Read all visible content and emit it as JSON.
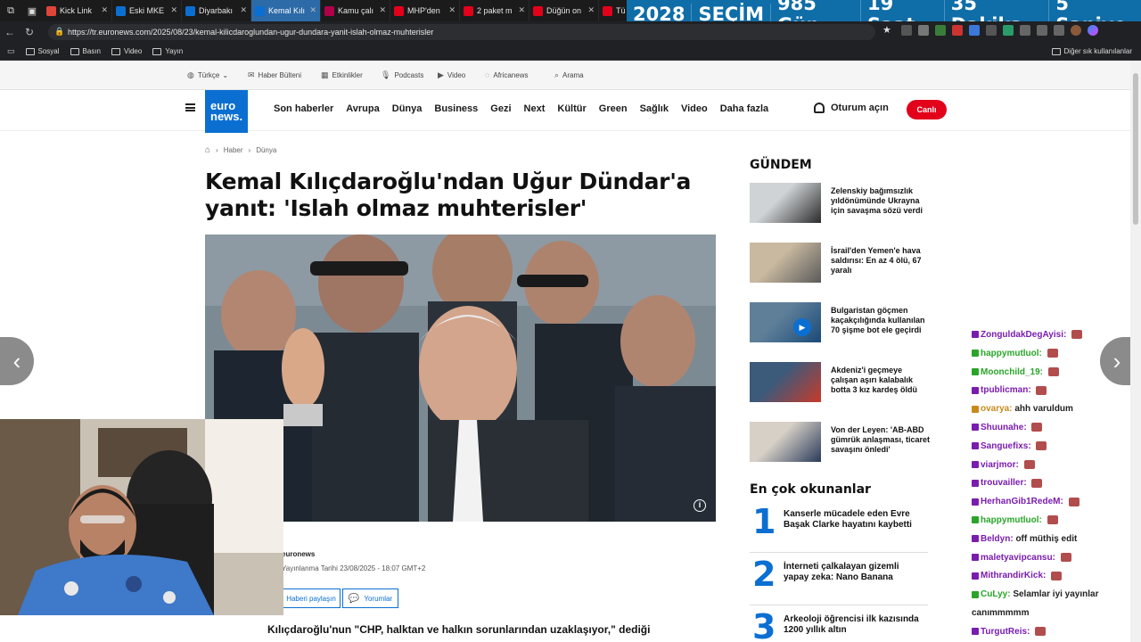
{
  "browser": {
    "tabs": [
      {
        "label": "Kick Link",
        "color": "#e0453a",
        "active": false
      },
      {
        "label": "Eski MKE",
        "color": "#0b6fd2",
        "active": false
      },
      {
        "label": "Diyarbakı",
        "color": "#0b6fd2",
        "active": false
      },
      {
        "label": "Kemal Kılı",
        "color": "#0b6fd2",
        "active": true
      },
      {
        "label": "Kamu çalı",
        "color": "#b0004a",
        "active": false
      },
      {
        "label": "MHP'den",
        "color": "#e3001b",
        "active": false
      },
      {
        "label": "2 paket m",
        "color": "#e3001b",
        "active": false
      },
      {
        "label": "Düğün on",
        "color": "#e3001b",
        "active": false
      },
      {
        "label": "Tü",
        "color": "#e3001b",
        "active": false
      }
    ],
    "url": "https://tr.euronews.com/2025/08/23/kemal-kilicdaroglundan-ugur-dundara-yanit-islah-olmaz-muhterisler",
    "bookmarks": [
      "Sosyal",
      "Basın",
      "Video",
      "Yayın"
    ],
    "bookmarks_other": "Diğer sık kullanılanlar"
  },
  "countdown": {
    "year": "2028",
    "label": "SEÇİM",
    "days": "985 Gün",
    "hours": "19 Saat",
    "minutes": "35 Dakika",
    "seconds": "5 Saniye"
  },
  "site": {
    "topbar": {
      "language": "Türkçe",
      "newsletter": "Haber Bülteni",
      "events": "Etkinlikler",
      "podcasts": "Podcasts",
      "video": "Video",
      "africanews": "Africanews",
      "search": "Arama"
    },
    "logo_line1": "euro",
    "logo_line2": "news.",
    "nav": [
      "Son haberler",
      "Avrupa",
      "Dünya",
      "Business",
      "Gezi",
      "Next",
      "Kültür",
      "Green",
      "Sağlık",
      "Video",
      "Daha fazla"
    ],
    "login": "Oturum açın",
    "live": "Canlı"
  },
  "article": {
    "breadcrumb": [
      "Haber",
      "Dünya"
    ],
    "title": "Kemal Kılıçdaroğlu'ndan Uğur Dündar'a yanıt: 'Islah olmaz muhterisler'",
    "author": "euronews",
    "date": "Yayınlanma Tarihi 23/08/2025 - 18:07 GMT+2",
    "share": "Haberi paylaşın",
    "comments": "Yorumlar",
    "lead": "Kılıçdaroğlu'nun \"CHP, halktan ve halkın sorunlarından uzaklaşıyor,\" dediği"
  },
  "gundem": {
    "heading": "GÜNDEM",
    "items": [
      "Zelenskiy bağımsızlık yıldönümünde Ukrayna için savaşma sözü verdi",
      "İsrail'den Yemen'e hava saldırısı: En az 4 ölü, 67 yaralı",
      "Bulgaristan göçmen kaçakçılığında kullanılan 70 şişme bot ele geçirdi",
      "Akdeniz'i geçmeye çalışan aşırı kalabalık botta 3 kız kardeş öldü",
      "Von der Leyen: 'AB-ABD gümrük anlaşması, ticaret savaşını önledi'"
    ]
  },
  "most_read": {
    "heading": "En çok okunanlar",
    "items": [
      {
        "num": "1",
        "text": "Kanserle mücadele eden Evre Başak Clarke hayatını kaybetti"
      },
      {
        "num": "2",
        "text": "İnterneti çalkalayan gizemli yapay zeka: Nano Banana"
      },
      {
        "num": "3",
        "text": "Arkeoloji öğrencisi ilk kazısında 1200 yıllık altın"
      }
    ]
  },
  "chat": [
    {
      "name": "ZonguldakDegAyisi:",
      "color": "#7a1cb0",
      "msg": ""
    },
    {
      "name": "happymutluol:",
      "color": "#2aa52a",
      "msg": ""
    },
    {
      "name": "Moonchild_19:",
      "color": "#2aa52a",
      "msg": ""
    },
    {
      "name": "tpublicman:",
      "color": "#7a1cb0",
      "msg": ""
    },
    {
      "name": "ovarya:",
      "color": "#c98a1c",
      "msg": "ahh varuldum"
    },
    {
      "name": "Shuunahe:",
      "color": "#7a1cb0",
      "msg": ""
    },
    {
      "name": "Sanguefixs:",
      "color": "#7a1cb0",
      "msg": ""
    },
    {
      "name": "viarjmor:",
      "color": "#7a1cb0",
      "msg": ""
    },
    {
      "name": "trouvailler:",
      "color": "#7a1cb0",
      "msg": ""
    },
    {
      "name": "HerhanGib1RedeM:",
      "color": "#7a1cb0",
      "msg": ""
    },
    {
      "name": "happymutluol:",
      "color": "#2aa52a",
      "msg": ""
    },
    {
      "name": "Beldyn:",
      "color": "#7a1cb0",
      "msg": "off müthiş edit"
    },
    {
      "name": "maletyavipcansu:",
      "color": "#7a1cb0",
      "msg": ""
    },
    {
      "name": "MithrandirKick:",
      "color": "#7a1cb0",
      "msg": ""
    },
    {
      "name": "CuLyy:",
      "color": "#2aa52a",
      "msg": "Selamlar iyi yayınlar canımmmmm"
    },
    {
      "name": "TurgutReis:",
      "color": "#7a1cb0",
      "msg": ""
    }
  ]
}
